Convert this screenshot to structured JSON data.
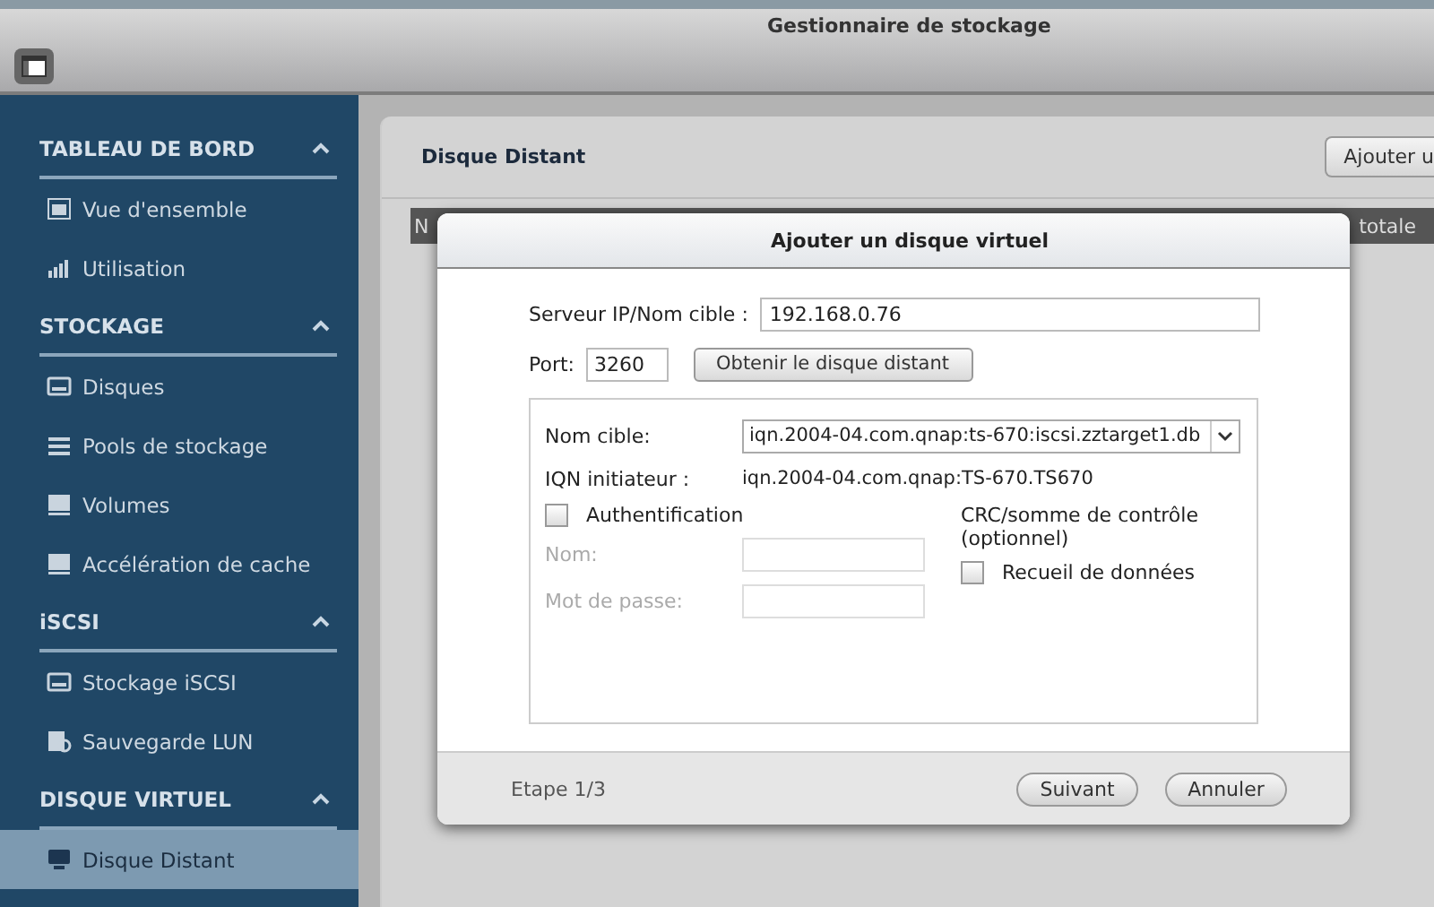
{
  "window": {
    "title": "Gestionnaire de stockage"
  },
  "sidebar": {
    "sections": [
      {
        "title": "TABLEAU DE BORD",
        "expanded": true,
        "items": [
          {
            "label": "Vue d'ensemble",
            "kind": "overview",
            "selected": false
          },
          {
            "label": "Utilisation",
            "kind": "chart",
            "selected": false
          }
        ]
      },
      {
        "title": "STOCKAGE",
        "expanded": true,
        "items": [
          {
            "label": "Disques",
            "kind": "disk",
            "selected": false
          },
          {
            "label": "Pools de stockage",
            "kind": "pools",
            "selected": false
          },
          {
            "label": "Volumes",
            "kind": "volume",
            "selected": false
          },
          {
            "label": "Accélération de cache",
            "kind": "volume",
            "selected": false
          }
        ]
      },
      {
        "title": "iSCSI",
        "expanded": true,
        "items": [
          {
            "label": "Stockage iSCSI",
            "kind": "disk",
            "selected": false
          },
          {
            "label": "Sauvegarde LUN",
            "kind": "backup",
            "selected": false
          }
        ]
      },
      {
        "title": "DISQUE VIRTUEL",
        "expanded": true,
        "items": [
          {
            "label": "Disque Distant",
            "kind": "remote",
            "selected": true
          }
        ]
      }
    ]
  },
  "panel": {
    "title": "Disque Distant",
    "add_button": "Ajouter u",
    "table": {
      "columns": [
        "N",
        "totale"
      ]
    }
  },
  "dialog": {
    "title": "Ajouter un disque virtuel",
    "server": {
      "label": "Serveur IP/Nom cible :",
      "value": "192.168.0.76"
    },
    "port": {
      "label": "Port:",
      "value": "3260"
    },
    "fetch_button": "Obtenir le disque distant",
    "target": {
      "label": "Nom cible:",
      "value": "iqn.2004-04.com.qnap:ts-670:iscsi.zztarget1.db"
    },
    "initiator": {
      "label": "IQN initiateur :",
      "value": "iqn.2004-04.com.qnap:TS-670.TS670"
    },
    "auth": {
      "label": "Authentification",
      "checked": false
    },
    "fields": [
      {
        "label": "Nom:",
        "disabled": true
      },
      {
        "label": "Mot de passe:",
        "disabled": true
      }
    ],
    "crc": {
      "label": "CRC/somme de contrôle (optionnel)",
      "options": [
        {
          "label": "Recueil de données",
          "checked": false
        }
      ]
    },
    "step": "Etape 1/3",
    "buttons": [
      "Suivant",
      "Annuler"
    ]
  }
}
